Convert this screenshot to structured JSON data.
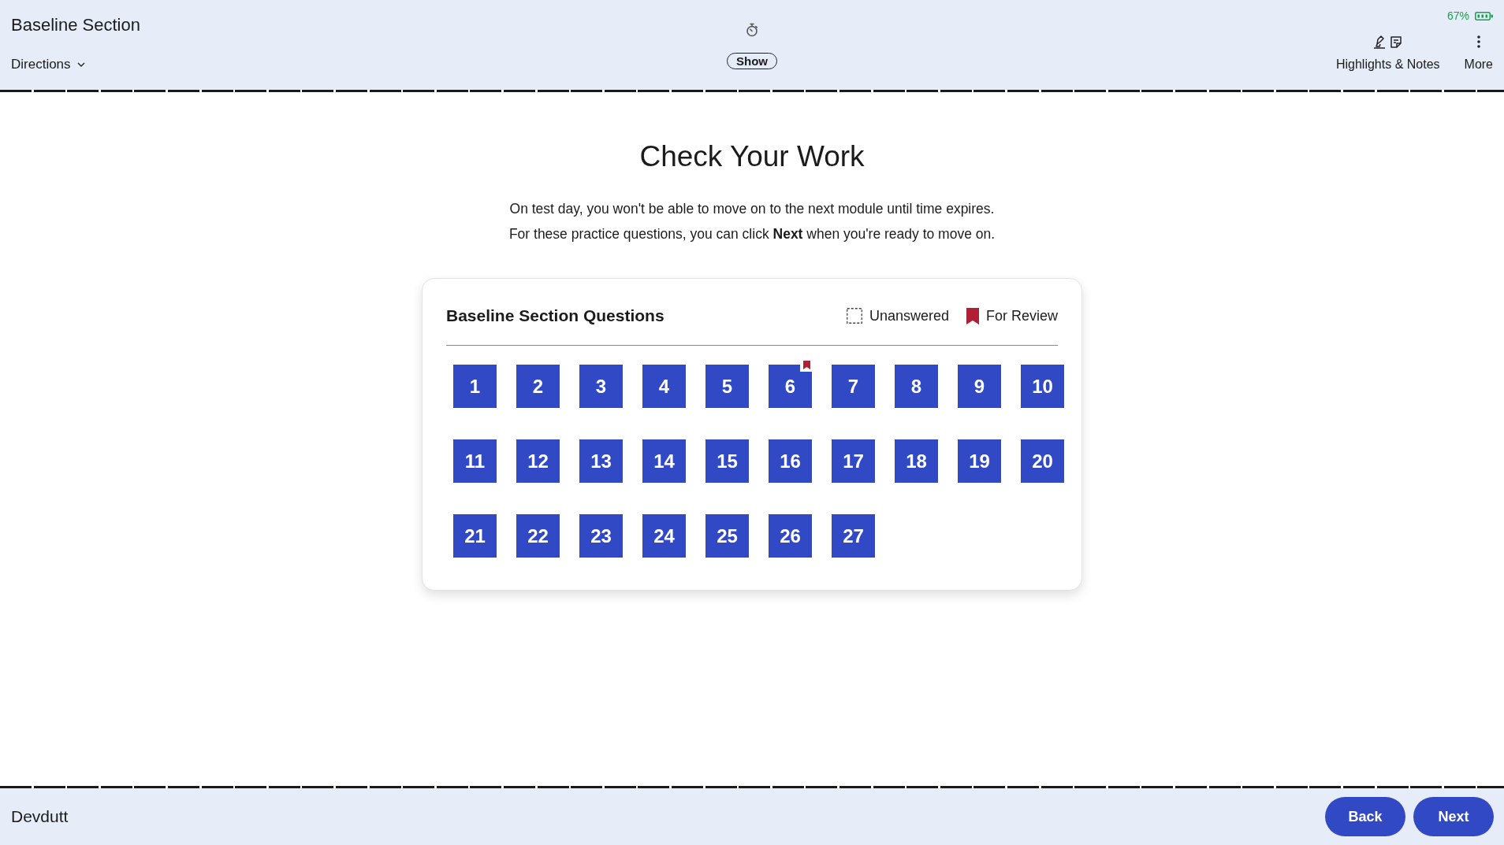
{
  "header": {
    "title": "Baseline Section",
    "directions": "Directions",
    "timer_button": "Show",
    "battery": "67%",
    "tools": [
      {
        "kind": "highlights_notes",
        "label": "Highlights & Notes"
      },
      {
        "kind": "more",
        "label": "More"
      }
    ]
  },
  "main": {
    "title": "Check Your Work",
    "paragraphs": [
      "On test day, you won't be able to move on to the next module until time expires.",
      "For these practice questions, you can click **Next** when you're ready to move on."
    ]
  },
  "card": {
    "title": "Baseline Section Questions",
    "legend": [
      {
        "kind": "unanswered",
        "label": "Unanswered"
      },
      {
        "kind": "review",
        "label": "For Review"
      }
    ],
    "questions": [
      {
        "label": "1",
        "answered": true,
        "for_review": false
      },
      {
        "label": "2",
        "answered": true,
        "for_review": false
      },
      {
        "label": "3",
        "answered": true,
        "for_review": false
      },
      {
        "label": "4",
        "answered": true,
        "for_review": false
      },
      {
        "label": "5",
        "answered": true,
        "for_review": false
      },
      {
        "label": "6",
        "answered": true,
        "for_review": true
      },
      {
        "label": "7",
        "answered": true,
        "for_review": false
      },
      {
        "label": "8",
        "answered": true,
        "for_review": false
      },
      {
        "label": "9",
        "answered": true,
        "for_review": false
      },
      {
        "label": "10",
        "answered": true,
        "for_review": false
      },
      {
        "label": "11",
        "answered": true,
        "for_review": false
      },
      {
        "label": "12",
        "answered": true,
        "for_review": false
      },
      {
        "label": "13",
        "answered": true,
        "for_review": false
      },
      {
        "label": "14",
        "answered": true,
        "for_review": false
      },
      {
        "label": "15",
        "answered": true,
        "for_review": false
      },
      {
        "label": "16",
        "answered": true,
        "for_review": false
      },
      {
        "label": "17",
        "answered": true,
        "for_review": false
      },
      {
        "label": "18",
        "answered": true,
        "for_review": false
      },
      {
        "label": "19",
        "answered": true,
        "for_review": false
      },
      {
        "label": "20",
        "answered": true,
        "for_review": false
      },
      {
        "label": "21",
        "answered": true,
        "for_review": false
      },
      {
        "label": "22",
        "answered": true,
        "for_review": false
      },
      {
        "label": "23",
        "answered": true,
        "for_review": false
      },
      {
        "label": "24",
        "answered": true,
        "for_review": false
      },
      {
        "label": "25",
        "answered": true,
        "for_review": false
      },
      {
        "label": "26",
        "answered": true,
        "for_review": false
      },
      {
        "label": "27",
        "answered": true,
        "for_review": false
      }
    ]
  },
  "footer": {
    "name": "Devdutt",
    "buttons": [
      {
        "label": "Back"
      },
      {
        "label": "Next"
      }
    ]
  }
}
